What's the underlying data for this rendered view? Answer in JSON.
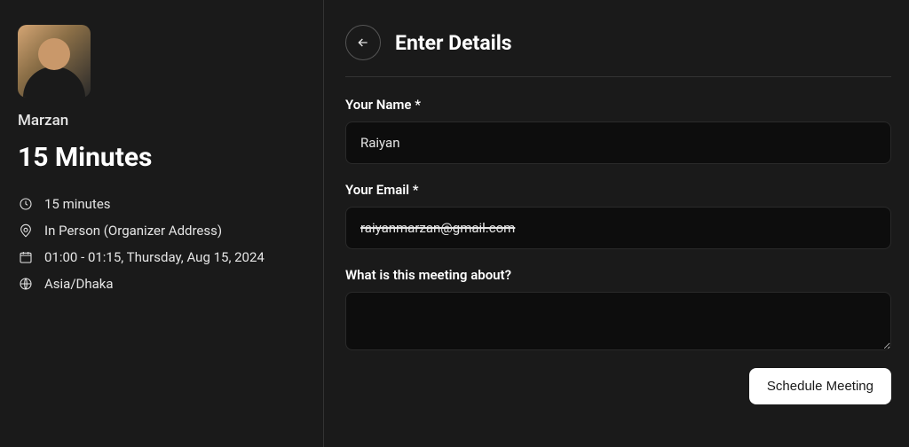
{
  "sidebar": {
    "organizer_name": "Marzan",
    "meeting_title": "15 Minutes",
    "info": {
      "duration": "15 minutes",
      "location": "In Person (Organizer Address)",
      "datetime": "01:00 - 01:15, Thursday, Aug 15, 2024",
      "timezone": "Asia/Dhaka"
    }
  },
  "form": {
    "page_title": "Enter Details",
    "labels": {
      "name": "Your Name *",
      "email": "Your Email *",
      "topic": "What is this meeting about?"
    },
    "values": {
      "name": "Raiyan",
      "email": "raiyanmarzan@gmail.com",
      "topic": ""
    },
    "submit_label": "Schedule Meeting"
  }
}
